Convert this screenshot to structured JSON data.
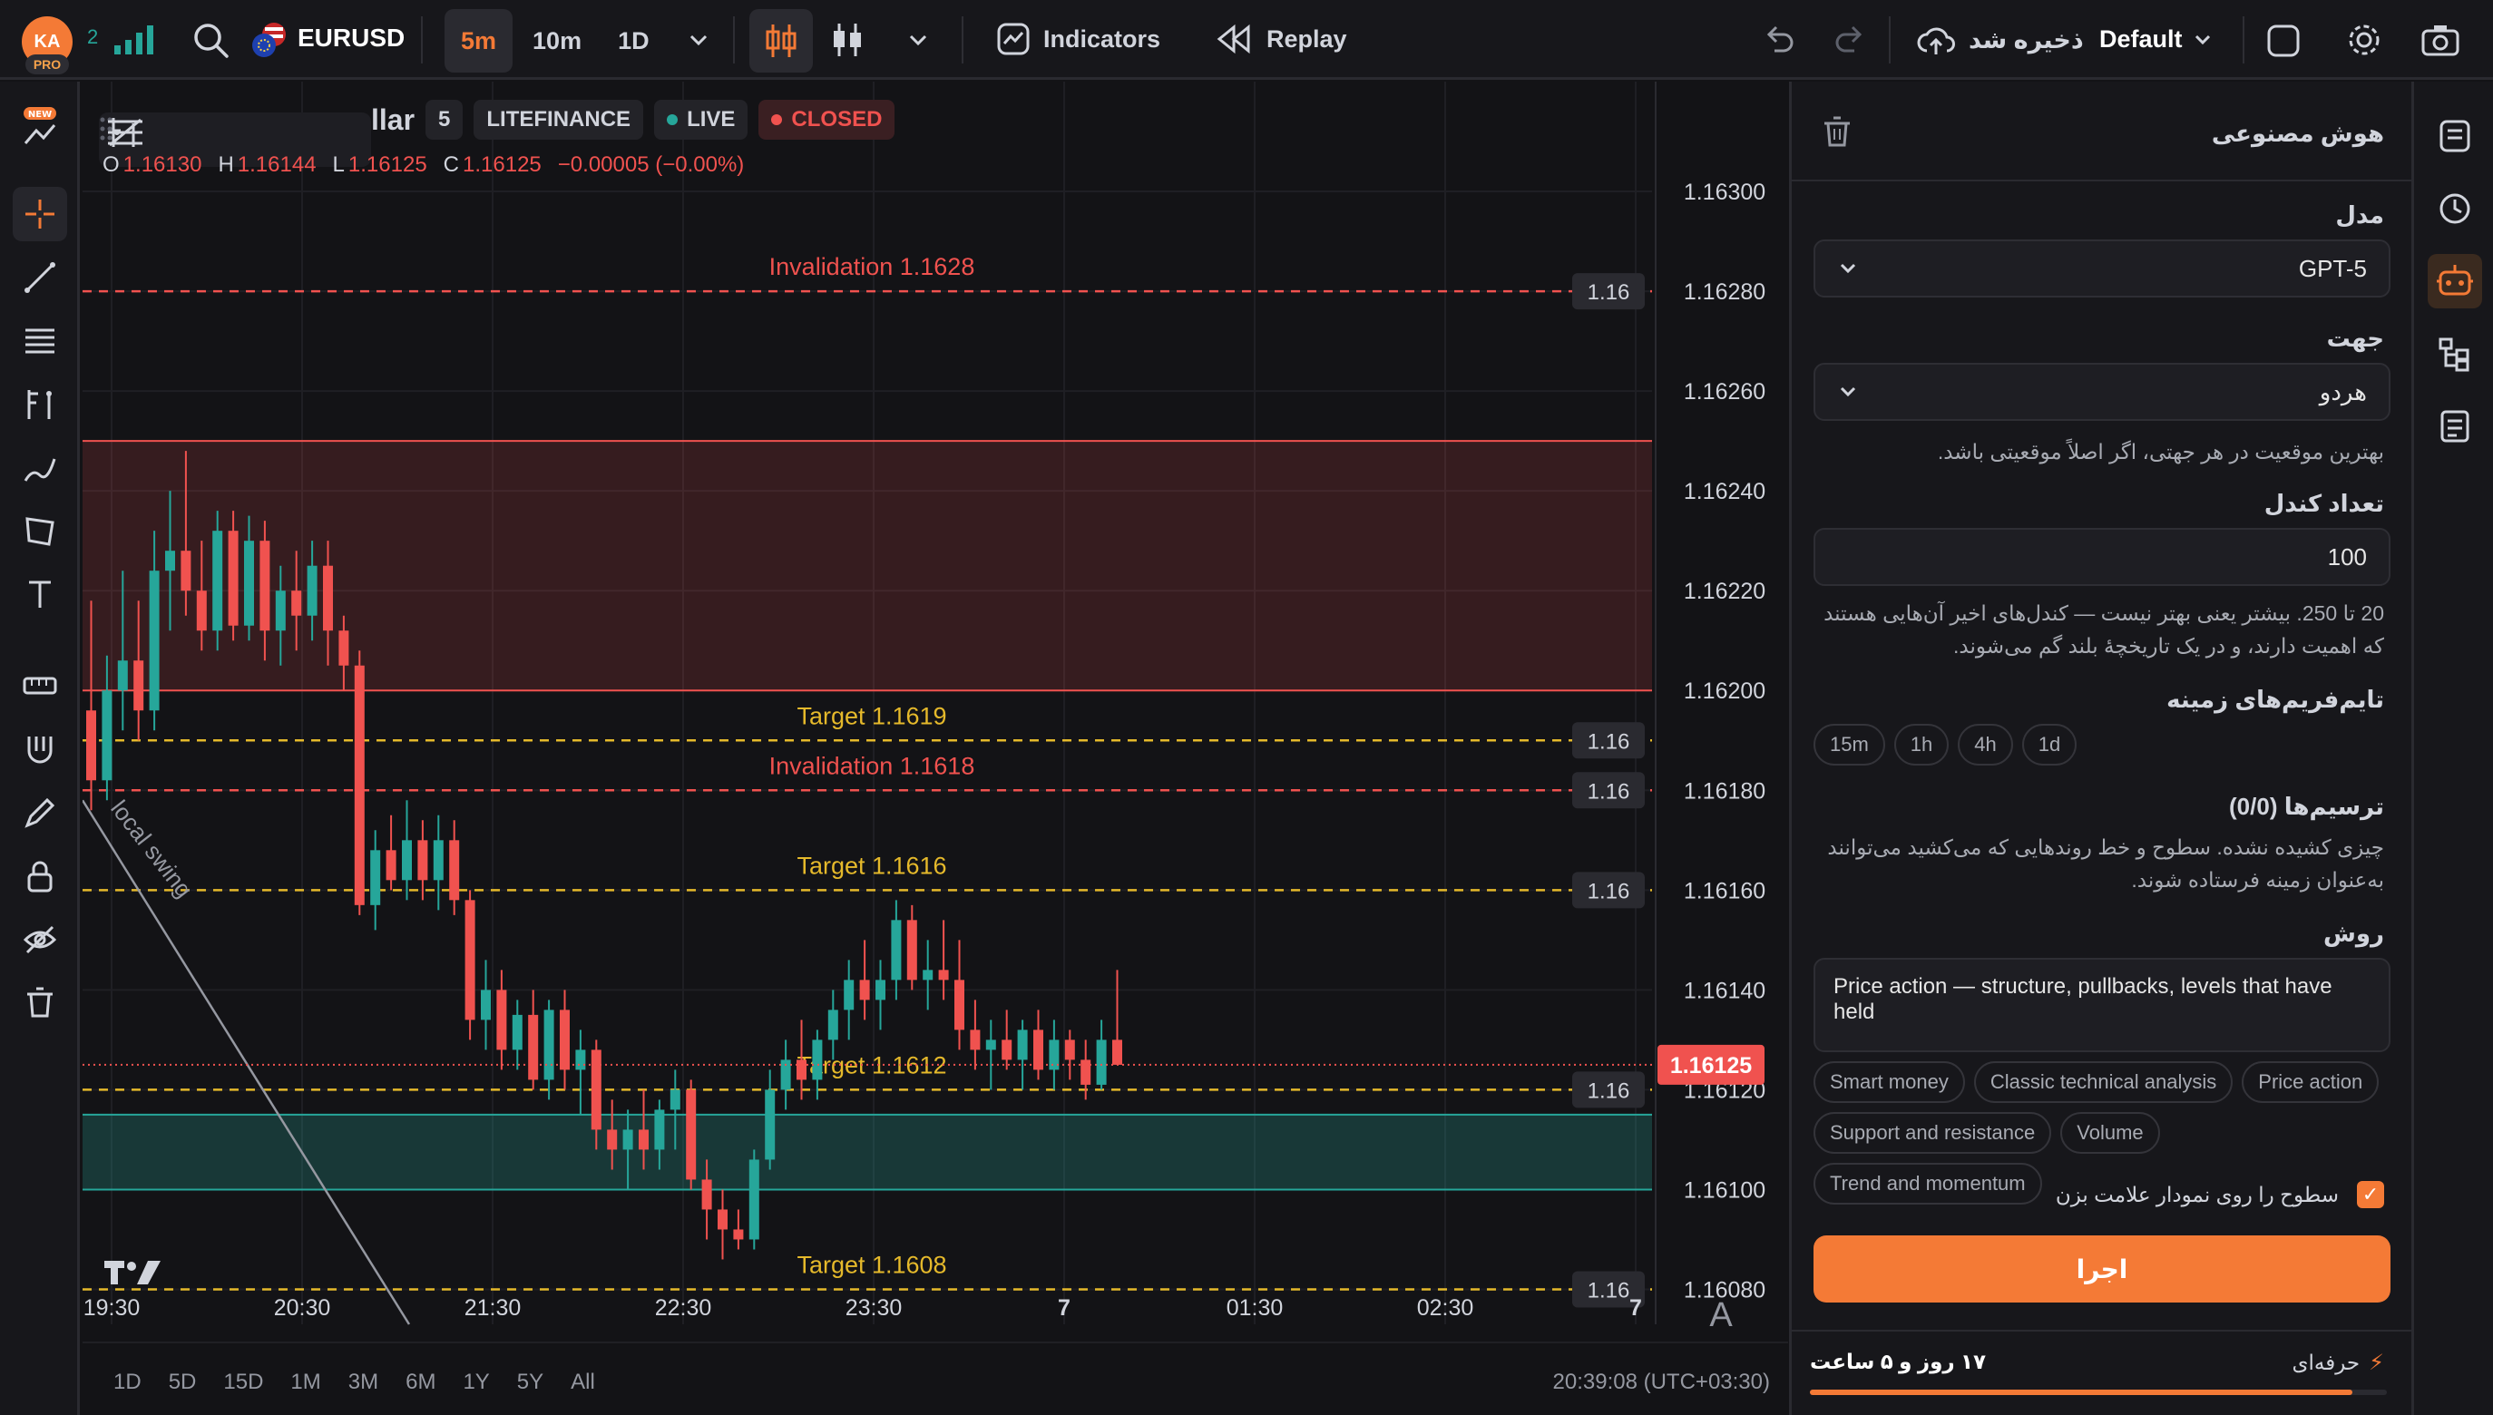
{
  "topbar": {
    "avatar_initials": "KA",
    "pro_badge": "PRO",
    "signal_count": "2",
    "symbol": "EURUSD",
    "timeframes": [
      "5m",
      "10m",
      "1D"
    ],
    "active_timeframe": "5m",
    "indicators_label": "Indicators",
    "replay_label": "Replay",
    "save_status": "ذخیره شد",
    "layout_name": "Default"
  },
  "chart_header": {
    "title_fragment": "llar",
    "interval": "5",
    "broker": "LITEFINANCE",
    "live_label": "LIVE",
    "closed_label": "CLOSED"
  },
  "ohlc": {
    "o_label": "O",
    "o": "1.16130",
    "h_label": "H",
    "h": "1.16144",
    "l_label": "L",
    "l": "1.16125",
    "c_label": "C",
    "c": "1.16125",
    "change": "−0.00005 (−0.00%)"
  },
  "chart_data": {
    "type": "candlestick",
    "symbol": "EURUSD",
    "y_ticks": [
      "1.16300",
      "1.16280",
      "1.16260",
      "1.16240",
      "1.16220",
      "1.16200",
      "1.16180",
      "1.16160",
      "1.16140",
      "1.16120",
      "1.16100",
      "1.16080"
    ],
    "ylim": [
      1.16073,
      1.16322
    ],
    "x_ticks": [
      "19:30",
      "20:30",
      "21:30",
      "22:30",
      "23:30",
      "7",
      "01:30",
      "02:30",
      "7"
    ],
    "current_price": "1.16125",
    "zones": [
      {
        "kind": "supply",
        "from": 1.162,
        "to": 1.1625,
        "color": "#f0524f"
      },
      {
        "kind": "demand",
        "from": 1.161,
        "to": 1.16115,
        "color": "#26a69a"
      }
    ],
    "levels": [
      {
        "label": "Invalidation 1.1628",
        "price": 1.1628,
        "tag": "1.16",
        "color": "#f0524f"
      },
      {
        "label": "Target 1.1619",
        "price": 1.1619,
        "tag": "1.16",
        "color": "#e5b92b"
      },
      {
        "label": "Invalidation 1.1618",
        "price": 1.1618,
        "tag": "1.16",
        "color": "#f0524f"
      },
      {
        "label": "Target 1.1616",
        "price": 1.1616,
        "tag": "1.16",
        "color": "#e5b92b"
      },
      {
        "label": "Target 1.1612",
        "price": 1.1612,
        "tag": "1.16",
        "color": "#e5b92b"
      },
      {
        "label": "Target 1.1608",
        "price": 1.1608,
        "tag": "1.16",
        "color": "#e5b92b"
      }
    ],
    "trendline_label": "local swing",
    "candles": [
      [
        1.16196,
        1.16218,
        1.16176,
        1.16182
      ],
      [
        1.16182,
        1.16207,
        1.16178,
        1.162
      ],
      [
        1.162,
        1.16224,
        1.16192,
        1.16206
      ],
      [
        1.16206,
        1.16218,
        1.1619,
        1.16196
      ],
      [
        1.16196,
        1.16232,
        1.16192,
        1.16224
      ],
      [
        1.16224,
        1.1624,
        1.16212,
        1.16228
      ],
      [
        1.16228,
        1.16248,
        1.16215,
        1.1622
      ],
      [
        1.1622,
        1.1623,
        1.16208,
        1.16212
      ],
      [
        1.16212,
        1.16236,
        1.16208,
        1.16232
      ],
      [
        1.16232,
        1.16236,
        1.1621,
        1.16213
      ],
      [
        1.16213,
        1.16235,
        1.1621,
        1.1623
      ],
      [
        1.1623,
        1.16234,
        1.16206,
        1.16212
      ],
      [
        1.16212,
        1.16225,
        1.16205,
        1.1622
      ],
      [
        1.1622,
        1.16228,
        1.16208,
        1.16215
      ],
      [
        1.16215,
        1.1623,
        1.1621,
        1.16225
      ],
      [
        1.16225,
        1.1623,
        1.16205,
        1.16212
      ],
      [
        1.16212,
        1.16215,
        1.162,
        1.16205
      ],
      [
        1.16205,
        1.16208,
        1.16155,
        1.16157
      ],
      [
        1.16157,
        1.16172,
        1.16152,
        1.16168
      ],
      [
        1.16168,
        1.16175,
        1.1616,
        1.16162
      ],
      [
        1.16162,
        1.16178,
        1.16158,
        1.1617
      ],
      [
        1.1617,
        1.16174,
        1.16158,
        1.16162
      ],
      [
        1.16162,
        1.16175,
        1.16156,
        1.1617
      ],
      [
        1.1617,
        1.16174,
        1.16155,
        1.16158
      ],
      [
        1.16158,
        1.1616,
        1.1613,
        1.16134
      ],
      [
        1.16134,
        1.16146,
        1.16128,
        1.1614
      ],
      [
        1.1614,
        1.16144,
        1.16124,
        1.16128
      ],
      [
        1.16128,
        1.16138,
        1.16124,
        1.16135
      ],
      [
        1.16135,
        1.1614,
        1.1612,
        1.16122
      ],
      [
        1.16122,
        1.16138,
        1.16118,
        1.16136
      ],
      [
        1.16136,
        1.1614,
        1.1612,
        1.16124
      ],
      [
        1.16124,
        1.16132,
        1.16115,
        1.16128
      ],
      [
        1.16128,
        1.1613,
        1.16108,
        1.16112
      ],
      [
        1.16112,
        1.16118,
        1.16104,
        1.16108
      ],
      [
        1.16108,
        1.16116,
        1.161,
        1.16112
      ],
      [
        1.16112,
        1.1612,
        1.16104,
        1.16108
      ],
      [
        1.16108,
        1.16118,
        1.16104,
        1.16116
      ],
      [
        1.16116,
        1.16124,
        1.16108,
        1.1612
      ],
      [
        1.1612,
        1.16122,
        1.161,
        1.16102
      ],
      [
        1.16102,
        1.16106,
        1.1609,
        1.16096
      ],
      [
        1.16096,
        1.161,
        1.16086,
        1.16092
      ],
      [
        1.16092,
        1.16096,
        1.16088,
        1.1609
      ],
      [
        1.1609,
        1.16108,
        1.16088,
        1.16106
      ],
      [
        1.16106,
        1.16124,
        1.16104,
        1.1612
      ],
      [
        1.1612,
        1.1613,
        1.16116,
        1.16126
      ],
      [
        1.16126,
        1.16134,
        1.16118,
        1.16122
      ],
      [
        1.16122,
        1.16132,
        1.16118,
        1.1613
      ],
      [
        1.1613,
        1.1614,
        1.16126,
        1.16136
      ],
      [
        1.16136,
        1.16146,
        1.1613,
        1.16142
      ],
      [
        1.16142,
        1.1615,
        1.16134,
        1.16138
      ],
      [
        1.16138,
        1.16146,
        1.16132,
        1.16142
      ],
      [
        1.16142,
        1.16158,
        1.16138,
        1.16154
      ],
      [
        1.16154,
        1.16157,
        1.1614,
        1.16142
      ],
      [
        1.16142,
        1.1615,
        1.16136,
        1.16144
      ],
      [
        1.16144,
        1.16154,
        1.16138,
        1.16142
      ],
      [
        1.16142,
        1.1615,
        1.16128,
        1.16132
      ],
      [
        1.16132,
        1.16138,
        1.16124,
        1.16128
      ],
      [
        1.16128,
        1.16134,
        1.1612,
        1.1613
      ],
      [
        1.1613,
        1.16136,
        1.16124,
        1.16126
      ],
      [
        1.16126,
        1.16134,
        1.1612,
        1.16132
      ],
      [
        1.16132,
        1.16136,
        1.16122,
        1.16124
      ],
      [
        1.16124,
        1.16134,
        1.1612,
        1.1613
      ],
      [
        1.1613,
        1.16132,
        1.16122,
        1.16126
      ],
      [
        1.16126,
        1.1613,
        1.16118,
        1.16121
      ],
      [
        1.16121,
        1.16134,
        1.1612,
        1.1613
      ],
      [
        1.1613,
        1.16144,
        1.16125,
        1.16125
      ]
    ]
  },
  "bottom_bar": {
    "ranges": [
      "1D",
      "5D",
      "15D",
      "1M",
      "3M",
      "6M",
      "1Y",
      "5Y",
      "All"
    ],
    "clock": "20:39:08 (UTC+03:30)",
    "auto_label": "A"
  },
  "panel": {
    "title": "هوش مصنوعی",
    "model_label": "مدل",
    "model_value": "GPT-5",
    "direction_label": "جهت",
    "direction_value": "هردو",
    "direction_help": "بهترین موقعیت در هر جهتی، اگر اصلاً موقعیتی باشد.",
    "candles_label": "تعداد کندل",
    "candles_value": "100",
    "candles_help": "20 تا 250. بیشتر یعنی بهتر نیست — کندل‌های اخیر آن‌هایی هستند که اهمیت دارند، و در یک تاریخچهٔ بلند گم می‌شوند.",
    "htf_label": "تایم‌فریم‌های زمینه",
    "htf_options": [
      "15m",
      "1h",
      "4h",
      "1d"
    ],
    "drawings_label": "ترسیم‌ها (0/0)",
    "drawings_help": "چیزی کشیده نشده. سطوح و خط روندهایی که می‌کشید می‌توانند به‌عنوان زمینه فرستاده شوند.",
    "method_label": "روش",
    "method_value": "Price action — structure, pullbacks, levels that have held",
    "method_chips": [
      "Smart money",
      "Classic technical analysis",
      "Price action",
      "Support and resistance",
      "Volume",
      "Trend and momentum"
    ],
    "mark_levels_label": "سطوح را روی نمودار علامت بزن",
    "run_label": "اجرا",
    "plan_label": "حرفه‌ای",
    "remaining": "۱۷ روز و ۵ ساعت",
    "plan_progress": 0.94
  },
  "colors": {
    "accent": "#f47a36",
    "bull": "#26a69a",
    "bear": "#f0524f",
    "target": "#e5b92b"
  }
}
